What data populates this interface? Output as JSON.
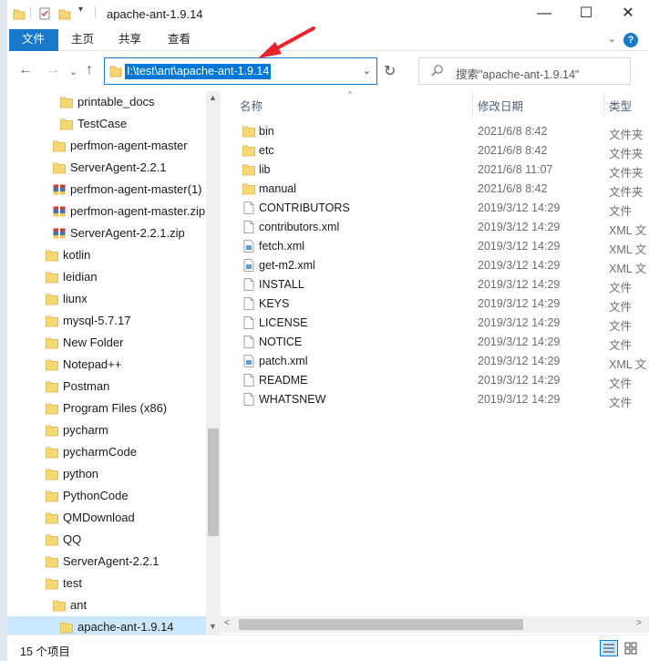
{
  "window": {
    "title": "apache-ant-1.9.14",
    "minimize": "—",
    "maximize": "☐",
    "close": "✕"
  },
  "ribbon": {
    "tabs": [
      {
        "label": "文件",
        "active": true
      },
      {
        "label": "主页",
        "active": false
      },
      {
        "label": "共享",
        "active": false
      },
      {
        "label": "查看",
        "active": false
      }
    ],
    "help": "?"
  },
  "address_bar": {
    "path": "I:\\test\\ant\\apache-ant-1.9.14",
    "search_placeholder": "搜索\"apache-ant-1.9.14\""
  },
  "nav_tree": [
    {
      "label": "printable_docs",
      "icon": "folder-icon",
      "indent": 2
    },
    {
      "label": "TestCase",
      "icon": "folder-icon",
      "indent": 2
    },
    {
      "label": "perfmon-agent-master",
      "icon": "folder-icon",
      "indent": 1
    },
    {
      "label": "ServerAgent-2.2.1",
      "icon": "folder-icon",
      "indent": 1
    },
    {
      "label": "perfmon-agent-master(1)",
      "icon": "zip-icon",
      "indent": 1
    },
    {
      "label": "perfmon-agent-master.zip",
      "icon": "zip-icon",
      "indent": 1
    },
    {
      "label": "ServerAgent-2.2.1.zip",
      "icon": "zip-icon",
      "indent": 1
    },
    {
      "label": "kotlin",
      "icon": "folder-icon",
      "indent": 0
    },
    {
      "label": "leidian",
      "icon": "folder-icon",
      "indent": 0
    },
    {
      "label": "liunx",
      "icon": "folder-icon",
      "indent": 0
    },
    {
      "label": "mysql-5.7.17",
      "icon": "folder-icon",
      "indent": 0
    },
    {
      "label": "New Folder",
      "icon": "folder-icon",
      "indent": 0
    },
    {
      "label": "Notepad++",
      "icon": "folder-icon",
      "indent": 0
    },
    {
      "label": "Postman",
      "icon": "folder-icon",
      "indent": 0
    },
    {
      "label": "Program Files (x86)",
      "icon": "folder-icon",
      "indent": 0
    },
    {
      "label": "pycharm",
      "icon": "folder-icon",
      "indent": 0
    },
    {
      "label": "pycharmCode",
      "icon": "folder-icon",
      "indent": 0
    },
    {
      "label": "python",
      "icon": "folder-icon",
      "indent": 0
    },
    {
      "label": "PythonCode",
      "icon": "folder-icon",
      "indent": 0
    },
    {
      "label": "QMDownload",
      "icon": "folder-icon",
      "indent": 0
    },
    {
      "label": "QQ",
      "icon": "folder-icon",
      "indent": 0
    },
    {
      "label": "ServerAgent-2.2.1",
      "icon": "folder-icon",
      "indent": 0
    },
    {
      "label": "test",
      "icon": "folder-icon",
      "indent": 0
    },
    {
      "label": "ant",
      "icon": "folder-icon",
      "indent": 1
    },
    {
      "label": "apache-ant-1.9.14",
      "icon": "folder-icon",
      "indent": 2,
      "selected": true
    }
  ],
  "columns": {
    "name": "名称",
    "date": "修改日期",
    "type": "类型"
  },
  "files": [
    {
      "name": "bin",
      "date": "2021/6/8 8:42",
      "type": "文件夹",
      "icon": "folder-icon"
    },
    {
      "name": "etc",
      "date": "2021/6/8 8:42",
      "type": "文件夹",
      "icon": "folder-icon"
    },
    {
      "name": "lib",
      "date": "2021/6/8 11:07",
      "type": "文件夹",
      "icon": "folder-icon"
    },
    {
      "name": "manual",
      "date": "2021/6/8 8:42",
      "type": "文件夹",
      "icon": "folder-icon"
    },
    {
      "name": "CONTRIBUTORS",
      "date": "2019/3/12 14:29",
      "type": "文件",
      "icon": "file-icon"
    },
    {
      "name": "contributors.xml",
      "date": "2019/3/12 14:29",
      "type": "XML 文",
      "icon": "file-icon"
    },
    {
      "name": "fetch.xml",
      "date": "2019/3/12 14:29",
      "type": "XML 文",
      "icon": "xml-icon"
    },
    {
      "name": "get-m2.xml",
      "date": "2019/3/12 14:29",
      "type": "XML 文",
      "icon": "xml-icon"
    },
    {
      "name": "INSTALL",
      "date": "2019/3/12 14:29",
      "type": "文件",
      "icon": "file-icon"
    },
    {
      "name": "KEYS",
      "date": "2019/3/12 14:29",
      "type": "文件",
      "icon": "file-icon"
    },
    {
      "name": "LICENSE",
      "date": "2019/3/12 14:29",
      "type": "文件",
      "icon": "file-icon"
    },
    {
      "name": "NOTICE",
      "date": "2019/3/12 14:29",
      "type": "文件",
      "icon": "file-icon"
    },
    {
      "name": "patch.xml",
      "date": "2019/3/12 14:29",
      "type": "XML 文",
      "icon": "xml-icon"
    },
    {
      "name": "README",
      "date": "2019/3/12 14:29",
      "type": "文件",
      "icon": "file-icon"
    },
    {
      "name": "WHATSNEW",
      "date": "2019/3/12 14:29",
      "type": "文件",
      "icon": "file-icon"
    }
  ],
  "status": {
    "count": "15 个项目"
  },
  "colors": {
    "accent": "#1979ca",
    "selection": "#cce8ff",
    "folder": "#f8d775",
    "annotation": "#e8232b"
  }
}
